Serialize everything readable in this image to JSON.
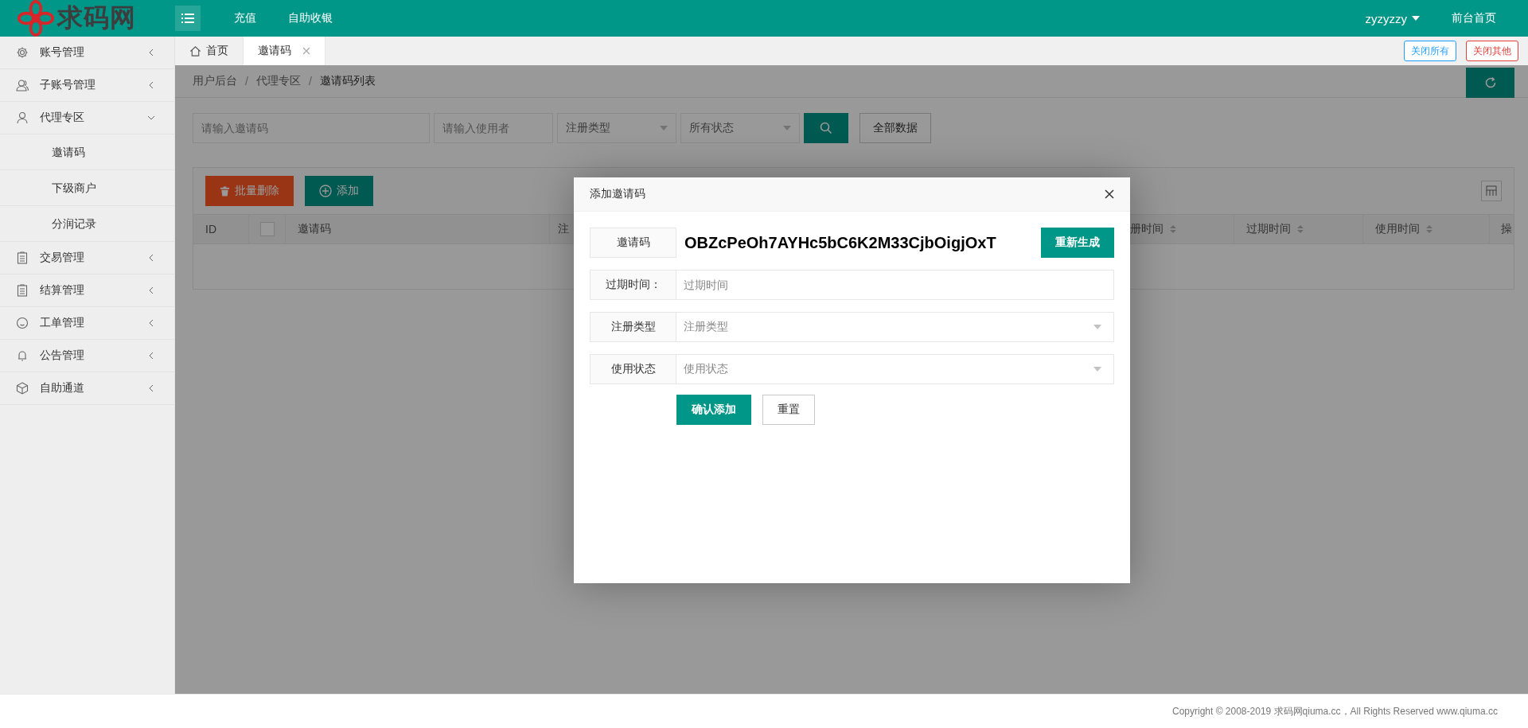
{
  "header": {
    "logo": "求码网",
    "nav": [
      "充值",
      "自助收银"
    ],
    "user": "zyzyzzy",
    "home_link": "前台首页"
  },
  "sidebar": {
    "items": [
      {
        "label": "账号管理",
        "expanded": false
      },
      {
        "label": "子账号管理",
        "expanded": false
      },
      {
        "label": "代理专区",
        "expanded": true,
        "children": [
          {
            "label": "邀请码"
          },
          {
            "label": "下级商户"
          },
          {
            "label": "分润记录"
          }
        ]
      },
      {
        "label": "交易管理",
        "expanded": false
      },
      {
        "label": "结算管理",
        "expanded": false
      },
      {
        "label": "工单管理",
        "expanded": false
      },
      {
        "label": "公告管理",
        "expanded": false
      },
      {
        "label": "自助通道",
        "expanded": false
      }
    ]
  },
  "tabs": [
    {
      "label": "首页",
      "selected": false
    },
    {
      "label": "邀请码",
      "selected": true
    }
  ],
  "tab_actions": [
    {
      "label": "关闭所有",
      "color": "#1e9fff"
    },
    {
      "label": "关闭其他",
      "color": "#e0413a"
    }
  ],
  "breadcrumb": [
    {
      "kind": "link",
      "text": "用户后台"
    },
    {
      "kind": "separator",
      "text": "/"
    },
    {
      "kind": "link",
      "text": "代理专区"
    },
    {
      "kind": "separator",
      "text": "/"
    },
    {
      "kind": "current",
      "text": "邀请码列表"
    }
  ],
  "filters": [
    {
      "kind": "input",
      "placeholder": "请输入邀请码"
    },
    {
      "kind": "input",
      "placeholder": "请输入使用者"
    },
    {
      "kind": "select",
      "placeholder": "注册类型"
    },
    {
      "kind": "select",
      "placeholder": "所有状态"
    }
  ],
  "all_button": "全部数据",
  "toolbar": [
    {
      "kind": "danger",
      "label": "批量删除"
    },
    {
      "kind": "primary",
      "label": "添加"
    }
  ],
  "table": {
    "columns": [
      {
        "kind": "text",
        "label": "ID"
      },
      {
        "kind": "checkbox",
        "checked": false
      },
      {
        "kind": "text",
        "label": "邀请码"
      },
      {
        "kind": "text",
        "label": "注"
      },
      {
        "kind": "sortable",
        "label": "册时间"
      },
      {
        "kind": "sortable",
        "label": "过期时间"
      },
      {
        "kind": "sortable",
        "label": "使用时间"
      },
      {
        "kind": "text",
        "label": "操"
      }
    ]
  },
  "modal": {
    "title": "添加邀请码",
    "code_label": "邀请码",
    "code": "OBZcPeOh7AYHc5bC6K2M33CjbOigjOxT",
    "regenerate": "重新生成",
    "fields": [
      {
        "kind": "input",
        "label": "过期时间：",
        "placeholder": "过期时间"
      },
      {
        "kind": "select",
        "label": "注册类型",
        "placeholder": "注册类型"
      },
      {
        "kind": "select",
        "label": "使用状态",
        "placeholder": "使用状态"
      }
    ],
    "buttons": [
      {
        "kind": "primary",
        "label": "确认添加"
      },
      {
        "kind": "plain",
        "label": "重置"
      }
    ]
  },
  "footer": "Copyright © 2008-2019 求码网qiuma.cc，All Rights Reserved www.qiuma.cc"
}
